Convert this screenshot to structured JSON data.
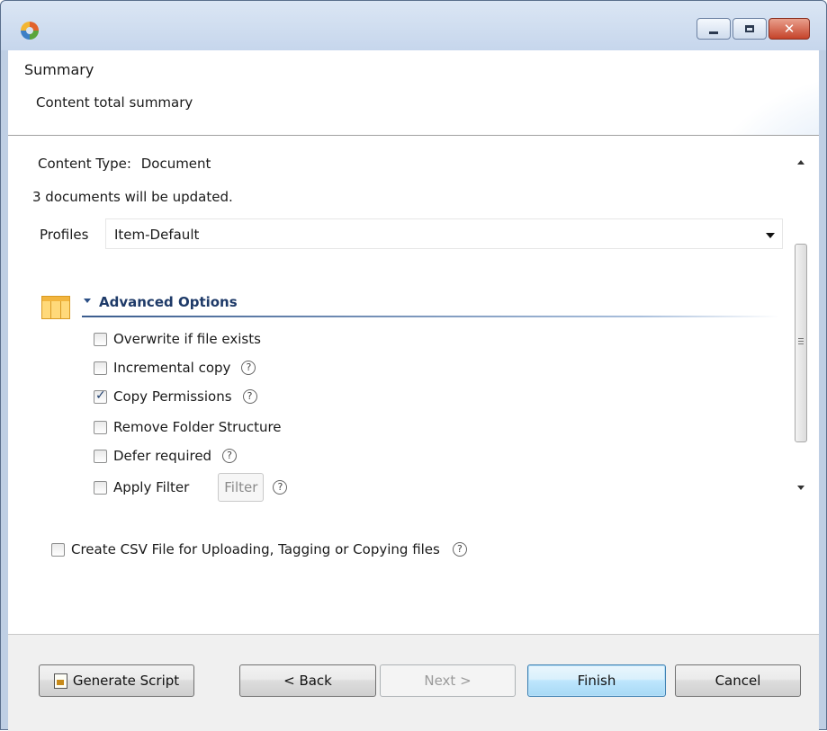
{
  "window": {
    "title": "",
    "app_icon": "app-logo-icon",
    "controls": [
      "minimize-icon",
      "maximize-icon",
      "close-icon"
    ],
    "close_glyph": "✕"
  },
  "header": {
    "title": "Summary",
    "subtitle": "Content total summary"
  },
  "content": {
    "content_type_label": "Content Type:",
    "content_type_value": "Document",
    "update_message": "3 documents will be updated.",
    "profiles_label": "Profiles",
    "profiles_selected": "Item-Default"
  },
  "advanced": {
    "title": "Advanced Options",
    "section_icon": "table-columns-icon",
    "options": [
      {
        "label": "Overwrite if file exists",
        "checked": false,
        "help": false
      },
      {
        "label": "Incremental copy",
        "checked": false,
        "help": true
      },
      {
        "label": "Copy Permissions",
        "checked": true,
        "help": true
      },
      {
        "label": "Remove Folder Structure",
        "checked": false,
        "help": false
      },
      {
        "label": "Defer required",
        "checked": false,
        "help": true
      },
      {
        "label": "Apply Filter",
        "checked": false,
        "help": true
      }
    ],
    "filter_button": "Filter"
  },
  "csv": {
    "label": "Create CSV File for Uploading, Tagging or Copying files",
    "checked": false
  },
  "help_glyph": "?",
  "footer": {
    "generate_script": "Generate Script",
    "back": "< Back",
    "next": "Next >",
    "finish": "Finish",
    "cancel": "Cancel"
  },
  "colors": {
    "window_frame": "#bfcfe4",
    "section_title": "#1e3a68",
    "default_button_border": "#3c7fb1"
  }
}
